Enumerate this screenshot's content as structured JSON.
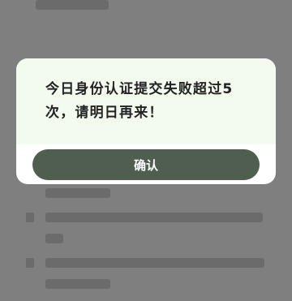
{
  "dialog": {
    "message": "今日身份认证提交失败超过5次，请明日再来！",
    "confirm_label": "确认"
  }
}
